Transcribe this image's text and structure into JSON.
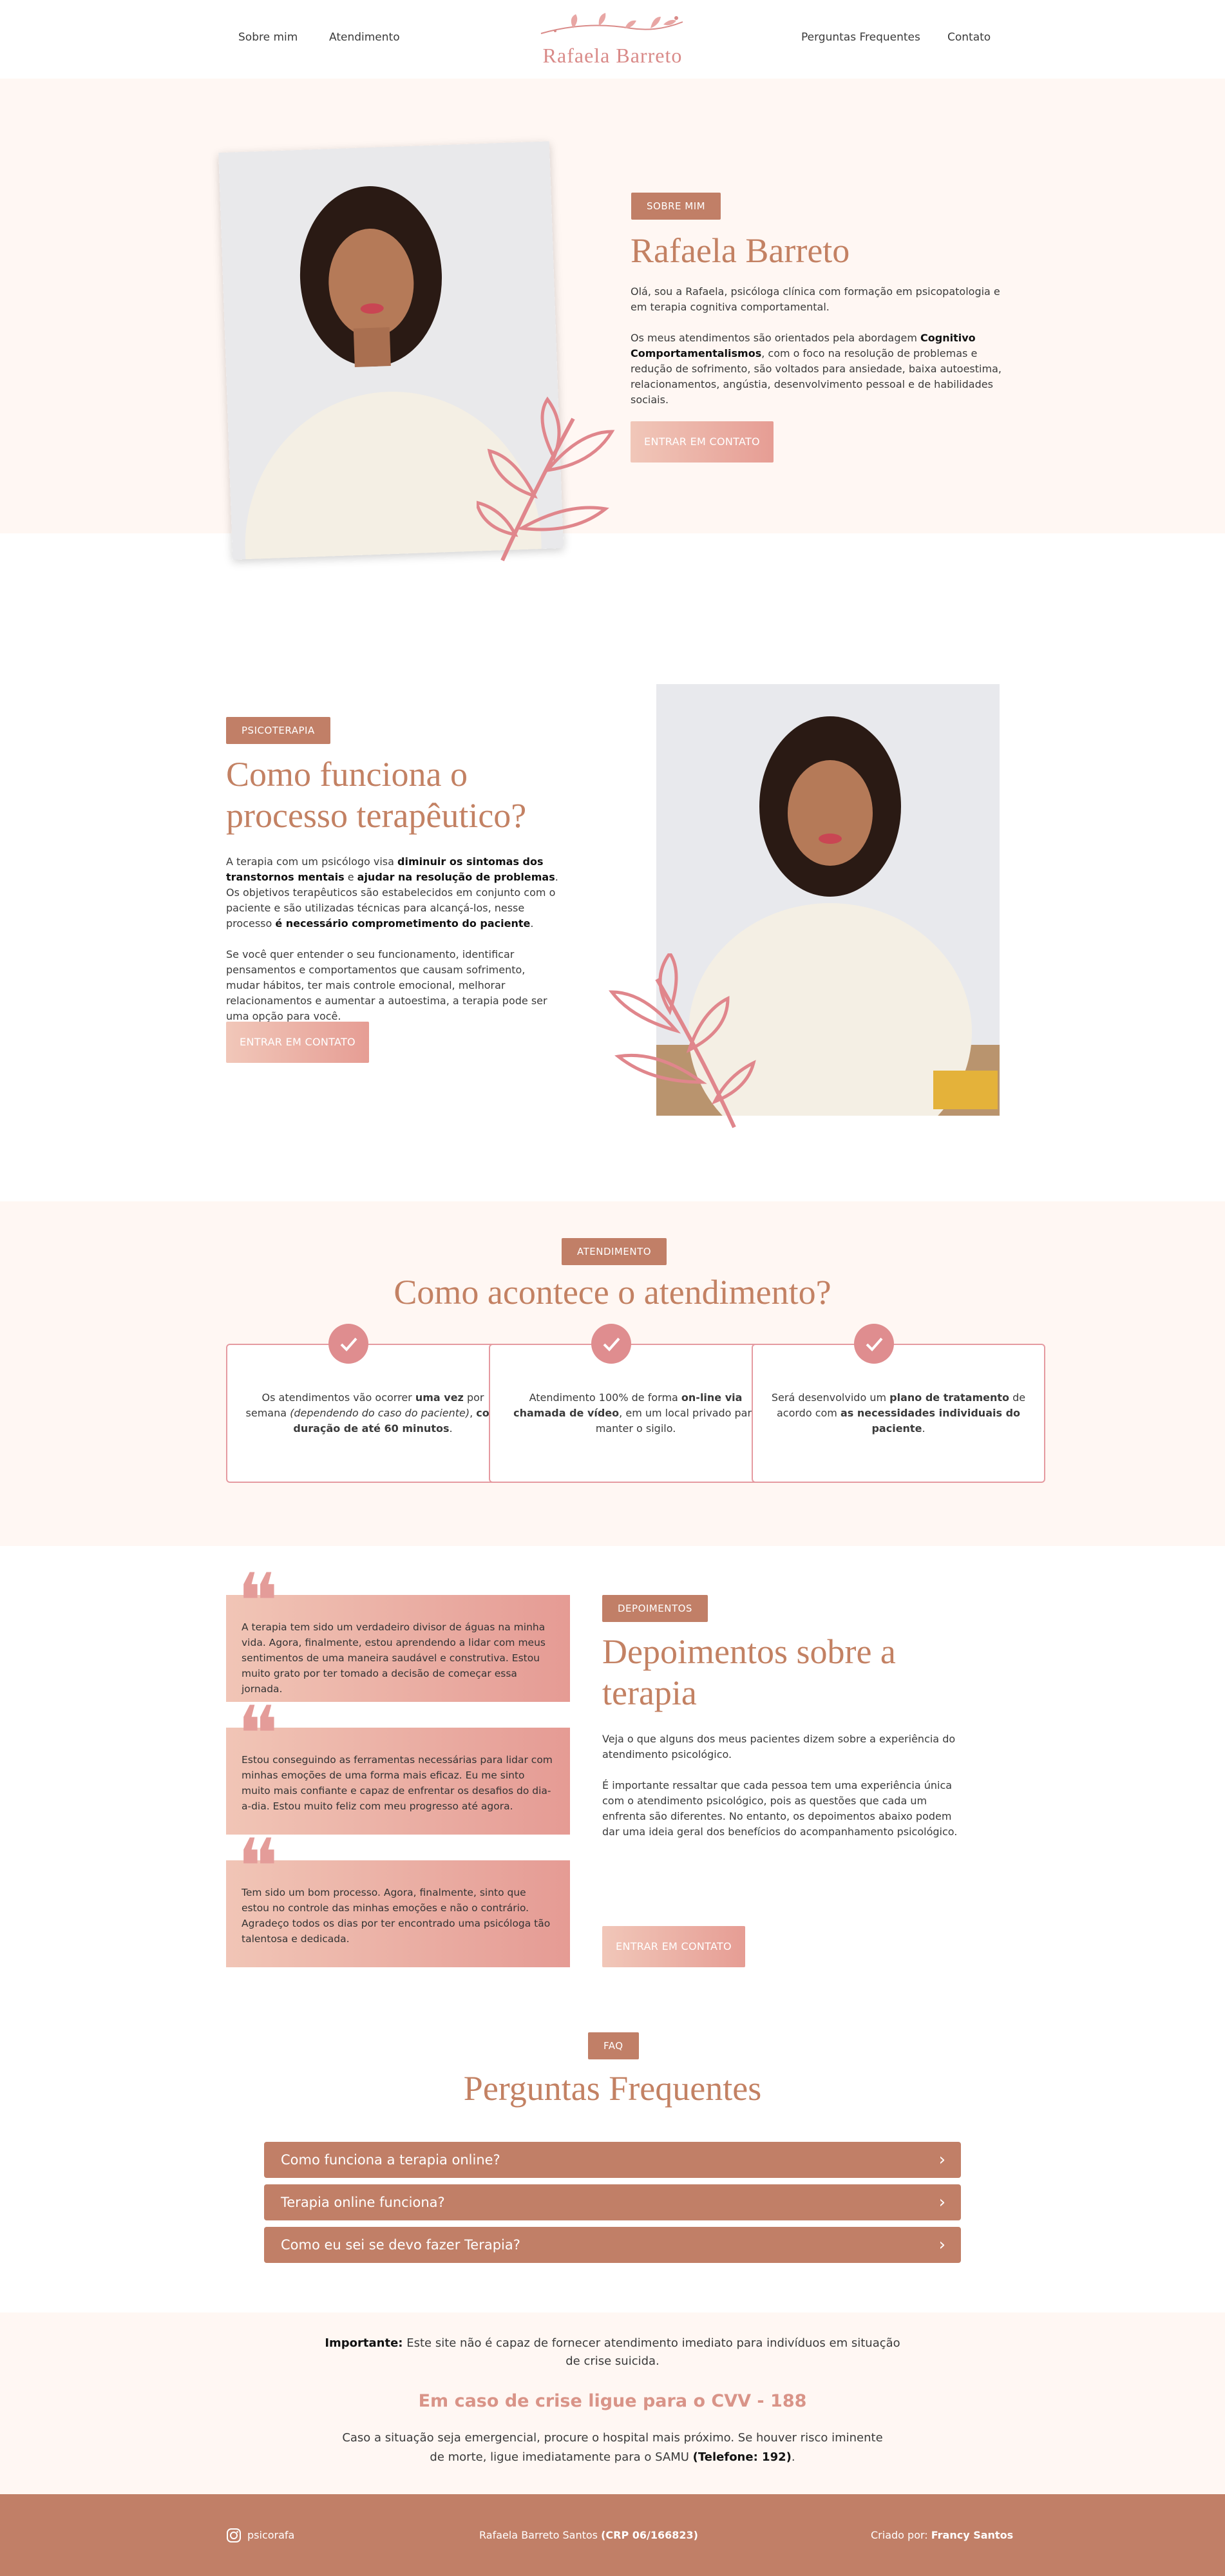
{
  "nav": {
    "items": [
      "Sobre mim",
      "Atendimento",
      "Perguntas Frequentes",
      "Contato"
    ],
    "logo": "Rafaela Barreto"
  },
  "about": {
    "badge": "SOBRE MIM",
    "title": "Rafaela Barreto",
    "p1": "Olá, sou a Rafaela, psicóloga clínica com formação em psicopatologia e em terapia cognitiva comportamental.",
    "p2_a": "Os meus atendimentos são orientados pela abordagem ",
    "p2_b": "Cognitivo Comportamentalismos",
    "p2_c": ", com o foco na resolução de problemas e redução de sofrimento, são voltados para ansiedade, baixa autoestima, relacionamentos, angústia, desenvolvimento pessoal e de habilidades sociais.",
    "button": "ENTRAR EM CONTATO"
  },
  "therapy": {
    "badge": "PSICOTERAPIA",
    "title": "Como funciona o processo terapêutico?",
    "p1_a": "A terapia com um psicólogo visa ",
    "p1_b": "diminuir os sintomas dos transtornos mentais",
    "p1_c": " e ",
    "p1_d": "ajudar na resolução de problemas",
    "p1_e": ". Os objetivos terapêuticos são estabelecidos em conjunto com o paciente e são utilizadas técnicas para alcançá-los, nesse processo ",
    "p1_f": "é necessário comprometimento do paciente",
    "p1_g": ".",
    "p2": "Se você quer entender o seu funcionamento, identificar pensamentos e comportamentos que causam sofrimento, mudar hábitos, ter mais controle emocional, melhorar relacionamentos e aumentar a autoestima, a terapia pode ser uma opção para você.",
    "button": "ENTRAR EM CONTATO"
  },
  "service": {
    "badge": "ATENDIMENTO",
    "title": "Como acontece o atendimento?",
    "cards": [
      {
        "a": "Os atendimentos vão ocorrer ",
        "b": "uma vez",
        "c": " por semana ",
        "d": "(dependendo do caso do paciente)",
        "e": ", ",
        "f": "com duração de até 60 minutos",
        "g": "."
      },
      {
        "a": "Atendimento 100% de forma ",
        "b": "on-line via chamada de vídeo",
        "c": ", em um local privado para manter o sigilo.",
        "d": "",
        "e": "",
        "f": "",
        "g": ""
      },
      {
        "a": "Será desenvolvido um ",
        "b": "plano de tratamento",
        "c": " de acordo com ",
        "d": "",
        "e": "",
        "f": "as necessidades individuais do paciente",
        "g": "."
      }
    ]
  },
  "testimonials": {
    "badge": "DEPOIMENTOS",
    "title": "Depoimentos sobre a terapia",
    "p1": "Veja o que alguns dos meus pacientes dizem sobre a experiência do atendimento psicológico.",
    "p2": "É importante ressaltar que cada pessoa tem uma experiência única com o atendimento psicológico, pois as questões que cada um enfrenta são diferentes. No entanto, os depoimentos abaixo podem dar uma ideia geral dos benefícios do acompanhamento psicológico.",
    "button": "ENTRAR EM CONTATO",
    "quotes": [
      "A terapia tem sido um verdadeiro divisor de águas na minha vida. Agora, finalmente, estou aprendendo a lidar com meus sentimentos de uma maneira saudável e construtiva. Estou muito grato por ter tomado a decisão de começar essa jornada.",
      "Estou conseguindo as ferramentas necessárias para lidar com minhas emoções de uma forma mais eficaz. Eu me sinto muito mais confiante e capaz de enfrentar os desafios do dia-a-dia. Estou muito feliz com meu progresso até agora.",
      "Tem sido um bom processo. Agora, finalmente, sinto que estou no controle das minhas emoções e não o contrário. Agradeço todos os dias por ter encontrado uma psicóloga tão talentosa e dedicada."
    ]
  },
  "faq": {
    "badge": "FAQ",
    "title": "Perguntas Frequentes",
    "items": [
      "Como funciona a terapia online?",
      "Terapia online funciona?",
      "Como eu sei se devo fazer Terapia?"
    ]
  },
  "notice": {
    "label": "Importante:",
    "text": " Este site não é capaz de fornecer atendimento imediato para indivíduos em situação de crise suicida.",
    "cvv": "Em caso de crise ligue para o CVV - 188",
    "emergency": "Caso a situação seja emergencial, procure o hospital mais próximo. Se houver risco iminente de morte, ligue imediatamente para o SAMU ",
    "phone": "(Telefone: 192)",
    "end": "."
  },
  "footer": {
    "instagram": "psicorafa",
    "name": "Rafaela Barreto Santos ",
    "crp": "(CRP 06/166823)",
    "credit": "Criado por: ",
    "author": "Francy Santos"
  },
  "colors": {
    "accent": "#c17f67",
    "pink": "#e59b94",
    "cream": "#fff7f3"
  }
}
